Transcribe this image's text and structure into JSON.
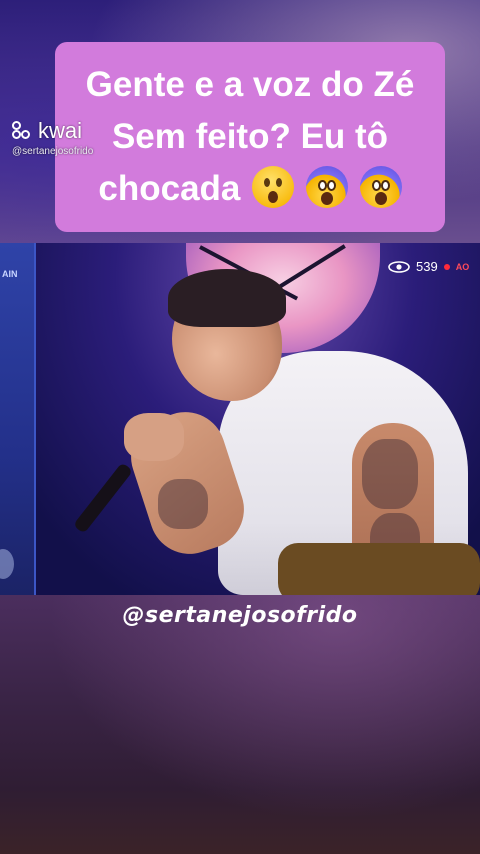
{
  "caption": {
    "line1": "Gente e a voz do Zé",
    "line2": "Sem feito? Eu tô",
    "line3": "chocada",
    "emojis": [
      "astonished-face-icon",
      "face-screaming-in-fear-icon",
      "face-screaming-in-fear-icon"
    ],
    "background_color": "#d27bdc"
  },
  "kwai": {
    "logo_text": "kwai",
    "handle": "@sertanejosofrido"
  },
  "video": {
    "viewer_count": "539",
    "live_label": "AO",
    "left_panel_text": "AIN"
  },
  "watermark": "@sertanejosofrido"
}
